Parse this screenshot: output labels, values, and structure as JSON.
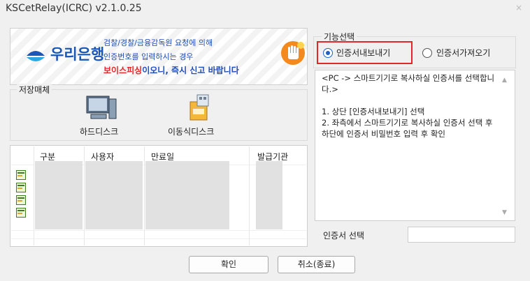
{
  "window": {
    "title": "KSCetRelay(ICRC) v2.1.0.25",
    "close_glyph": "×"
  },
  "banner": {
    "bank_name": "우리은행",
    "line1": "검찰/경찰/금융감독원 요청에 의해",
    "line2": "인증번호를 입력하시는 경우",
    "line3_red": "보이스피싱",
    "line3_rest": "이오니, 즉시 신고 바랍니다"
  },
  "storage": {
    "label": "저장매체",
    "items": [
      {
        "label": "하드디스크",
        "icon": "hard-disk-icon"
      },
      {
        "label": "이동식디스크",
        "icon": "removable-disk-icon"
      }
    ]
  },
  "table": {
    "columns": [
      "구분",
      "사용자",
      "만료일",
      "발급기관"
    ],
    "rows": [
      {
        "icon": "certificate-icon"
      },
      {
        "icon": "certificate-icon"
      },
      {
        "icon": "certificate-icon"
      },
      {
        "icon": "certificate-icon"
      }
    ]
  },
  "function": {
    "label": "기능선택",
    "options": [
      {
        "label": "인증서내보내기",
        "selected": true
      },
      {
        "label": "인증서가져오기",
        "selected": false
      }
    ]
  },
  "info": {
    "text": "<PC -> 스마트기기로 복사하실 인증서를 선택합니다.>\n\n1. 상단 [인증서내보내기] 선택\n2. 좌측에서 스마트기기로 복사하실 인증서 선택 후 하단에 인증서 비밀번호 입력 후 확인"
  },
  "cert_select": {
    "label": "인증서 선택",
    "value": ""
  },
  "buttons": {
    "ok": "확인",
    "cancel": "취소(종료)"
  },
  "colors": {
    "accent": "#1f5fc4",
    "highlight": "#e3262a",
    "brand": "#1a56b8"
  }
}
